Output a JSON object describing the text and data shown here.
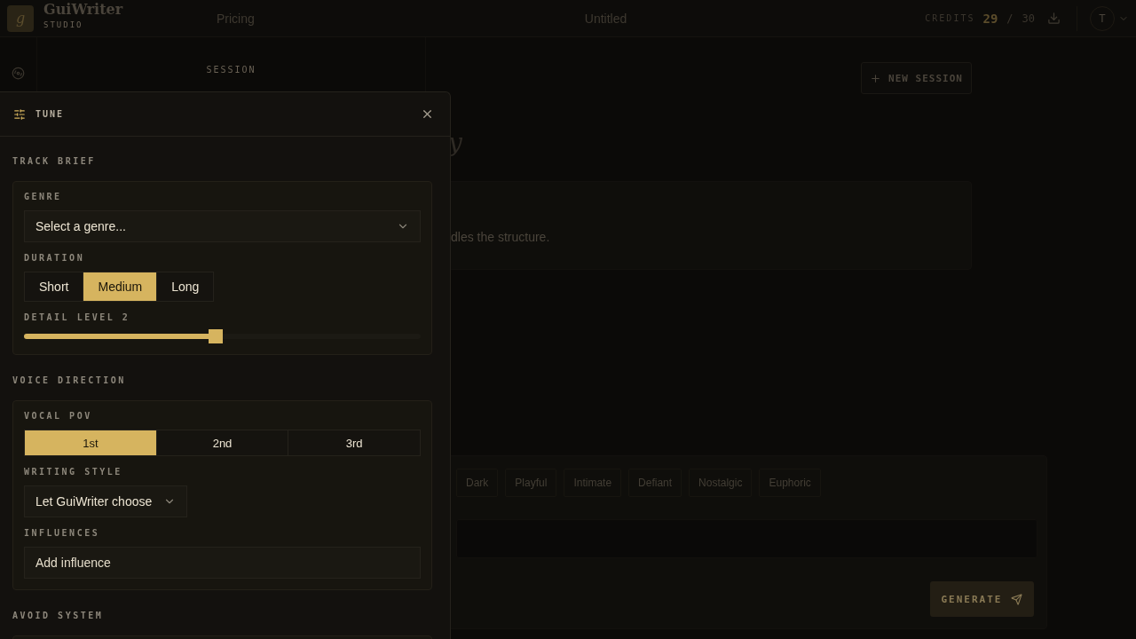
{
  "header": {
    "logo_letter": "g",
    "brand": "GuiWriter",
    "brand_sub": "STUDIO",
    "nav": [
      {
        "label": "Pricing"
      }
    ],
    "document_title": "Untitled",
    "credits": {
      "label": "CREDITS",
      "used": "29",
      "separator": "/",
      "total": "30"
    },
    "avatar": "T"
  },
  "session": {
    "label": "SESSION",
    "new_button": "NEW SESSION",
    "heading_fragment": "y",
    "intro_fragment": "dles the structure."
  },
  "composer": {
    "moods": [
      {
        "label": "Dark",
        "selected": false
      },
      {
        "label": "Playful",
        "selected": false
      },
      {
        "label": "Intimate",
        "selected": false
      },
      {
        "label": "Defiant",
        "selected": false
      },
      {
        "label": "Nostalgic",
        "selected": false
      },
      {
        "label": "Euphoric",
        "selected": false
      }
    ],
    "generate_button": "GENERATE"
  },
  "tune_panel": {
    "title": "TUNE",
    "sections": [
      {
        "title": "TRACK BRIEF",
        "fields": [
          {
            "kind": "select",
            "label": "GENRE",
            "value": "Select a genre...",
            "compact": false
          },
          {
            "kind": "segmented",
            "label": "DURATION",
            "stretch": false,
            "options": [
              {
                "label": "Short",
                "selected": false
              },
              {
                "label": "Medium",
                "selected": true
              },
              {
                "label": "Long",
                "selected": false
              }
            ]
          },
          {
            "kind": "slider",
            "label": "DETAIL LEVEL 2",
            "level": 0.5
          }
        ]
      },
      {
        "title": "VOICE DIRECTION",
        "fields": [
          {
            "kind": "segmented",
            "label": "VOCAL POV",
            "stretch": true,
            "options": [
              {
                "label": "1st",
                "selected": true
              },
              {
                "label": "2nd",
                "selected": false
              },
              {
                "label": "3rd",
                "selected": false
              }
            ]
          },
          {
            "kind": "select",
            "label": "WRITING STYLE",
            "value": "Let GuiWriter choose",
            "compact": true
          },
          {
            "kind": "input",
            "label": "INFLUENCES",
            "placeholder": "Add influence"
          }
        ]
      },
      {
        "title": "AVOID SYSTEM"
      }
    ]
  }
}
